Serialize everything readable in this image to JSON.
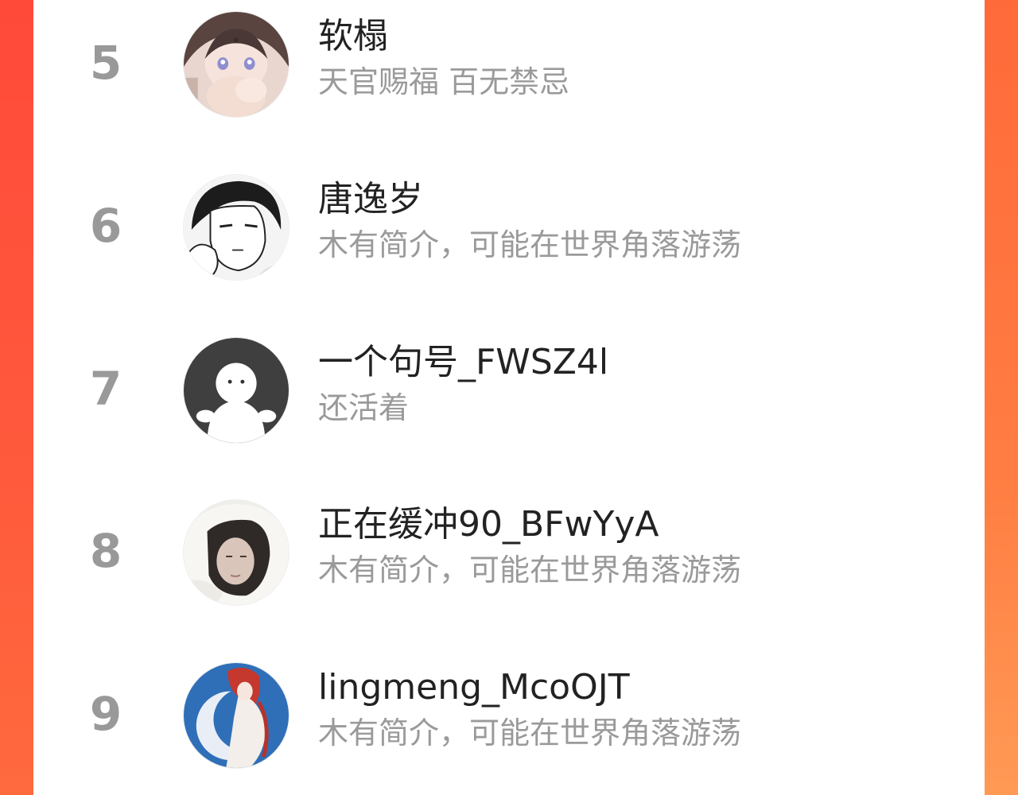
{
  "accent_color": "#ff5a3c",
  "list": {
    "items": [
      {
        "rank": "5",
        "name": "软榻",
        "bio": "天官赐福 百无禁忌",
        "avatar_icon": "avatar-anime-girl"
      },
      {
        "rank": "6",
        "name": "唐逸岁",
        "bio": "木有简介，可能在世界角落游荡",
        "avatar_icon": "avatar-manga-boy"
      },
      {
        "rank": "7",
        "name": "一个句号_FWSZ4l",
        "bio": "还活着",
        "avatar_icon": "avatar-default-figure"
      },
      {
        "rank": "8",
        "name": "正在缓冲90_BFwYyA",
        "bio": "木有简介，可能在世界角落游荡",
        "avatar_icon": "avatar-photo-girl"
      },
      {
        "rank": "9",
        "name": "lingmeng_McoOJT",
        "bio": "木有简介，可能在世界角落游荡",
        "avatar_icon": "avatar-illustration-moon"
      }
    ]
  }
}
